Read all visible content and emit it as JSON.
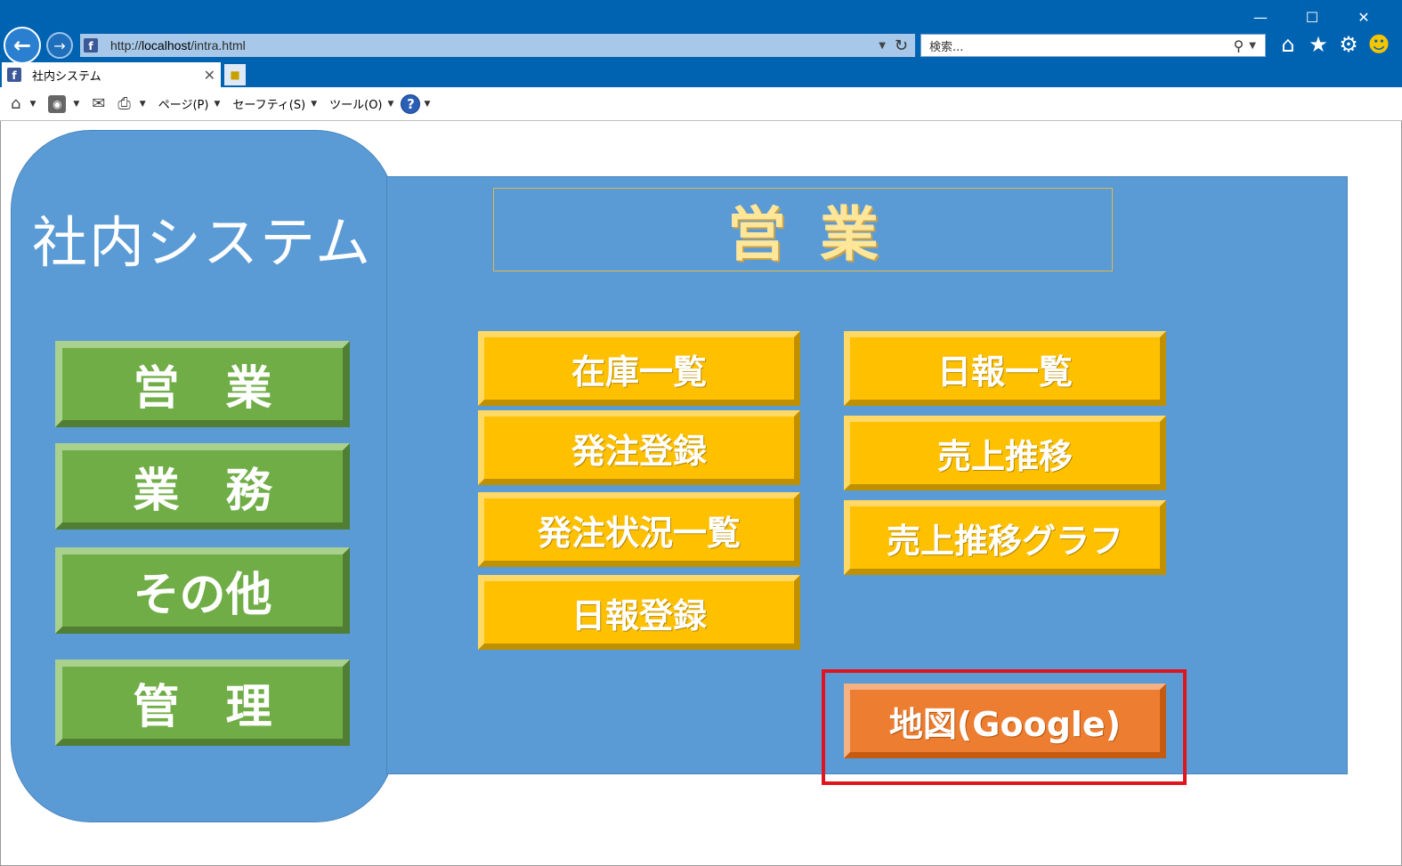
{
  "browser": {
    "address_url_prefix": "http://",
    "address_url_host": "localhost",
    "address_url_path": "/intra.html",
    "search_placeholder": "検索...",
    "tab_title": "社内システム",
    "window_controls": {
      "minimize": "—",
      "maximize": "☐",
      "close": "✕"
    },
    "commands": {
      "page": "ページ(P)",
      "safety": "セーフティ(S)",
      "tools": "ツール(O)"
    }
  },
  "sidebar": {
    "title": "社内システム",
    "buttons": [
      {
        "label": "営　業"
      },
      {
        "label": "業　務"
      },
      {
        "label": "その他"
      },
      {
        "label": "管　理"
      }
    ]
  },
  "main": {
    "section_title": "営業",
    "left_buttons": [
      {
        "label": "在庫一覧"
      },
      {
        "label": "発注登録"
      },
      {
        "label": "発注状況一覧"
      },
      {
        "label": "日報登録"
      }
    ],
    "right_buttons": [
      {
        "label": "日報一覧"
      },
      {
        "label": "売上推移"
      },
      {
        "label": "売上推移グラフ"
      }
    ],
    "map_button": {
      "label": "地図(Google)"
    }
  },
  "colors": {
    "chrome_blue": "#0063b1",
    "panel_blue": "#5b9bd5",
    "nav_green": "#70ad47",
    "menu_yellow": "#ffc000",
    "map_orange": "#ed7d31",
    "highlight_red": "#e0141e"
  }
}
